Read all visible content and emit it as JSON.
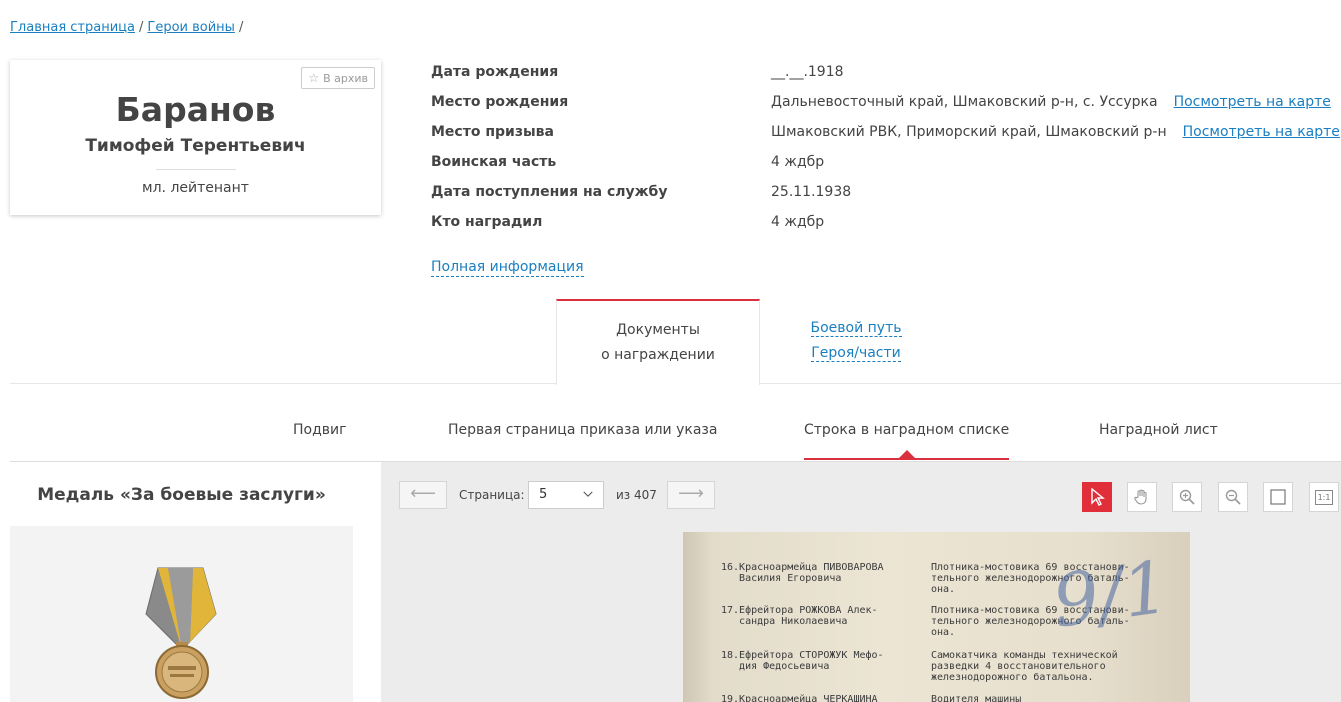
{
  "breadcrumb": [
    {
      "label": "Главная страница"
    },
    {
      "label": "Герои войны"
    }
  ],
  "breadcrumb_sep": "/",
  "hero": {
    "archive_label": "В архив",
    "surname": "Баранов",
    "given_names": "Тимофей Терентьевич",
    "rank": "мл. лейтенант"
  },
  "info": {
    "rows": [
      {
        "label": "Дата рождения",
        "value": "__.__.1918",
        "link": ""
      },
      {
        "label": "Место рождения",
        "value": "Дальневосточный край, Шмаковский р-н, с. Уссурка",
        "link": "Посмотреть на карте"
      },
      {
        "label": "Место призыва",
        "value": "Шмаковский РВК, Приморский край, Шмаковский р-н",
        "link": "Посмотреть на карте"
      },
      {
        "label": "Воинская часть",
        "value": "4 ждбр",
        "link": ""
      },
      {
        "label": "Дата поступления на службу",
        "value": "25.11.1938",
        "link": ""
      },
      {
        "label": "Кто наградил",
        "value": "4 ждбр",
        "link": ""
      }
    ],
    "full_info_label": "Полная информация"
  },
  "main_tabs": {
    "docs_line1": "Документы",
    "docs_line2": "о награждении",
    "path_line1": "Боевой путь",
    "path_line2": "Героя/части"
  },
  "sub_tabs": [
    {
      "label": "Подвиг"
    },
    {
      "label": "Первая страница приказа или указа"
    },
    {
      "label": "Строка в наградном списке",
      "active": true
    },
    {
      "label": "Наградной лист"
    }
  ],
  "award": {
    "title": "Медаль «За боевые заслуги»"
  },
  "viewer": {
    "prev_arrow": "⟵",
    "next_arrow": "⟶",
    "page_label": "Страница:",
    "page_value": "5",
    "page_of": "из 407",
    "tools": [
      "pointer-icon",
      "hand-icon",
      "zoom-in-icon",
      "zoom-out-icon",
      "fit-page-icon",
      "actual-size-icon"
    ],
    "tool_actual_size_text": "1:1"
  },
  "document_text": {
    "entries": [
      {
        "left": "16.Красноармейца ПИВОВАРОВА\n   Василия Егоровича",
        "right": "Плотника-мостовика 69 восстанови-\nтельного железнодорожного баталь-\nона."
      },
      {
        "left": "17.Ефрейтора РОЖКОВА Алек-\n   сандра Николаевича",
        "right": "Плотника-мостовика 69 восстанови-\nтельного железнодорожного баталь-\nона."
      },
      {
        "left": "18.Ефрейтора СТОРОЖУК Мефо-\n   дия Федосьевича",
        "right": "Самокатчика команды технической\nразведки 4 восстановительного\nжелезнодорожного батальона."
      },
      {
        "left": "19.Красноармейца ЧЕРКАШИНА",
        "right": "Водителя машины"
      }
    ],
    "signature": "9/1"
  },
  "colors": {
    "link": "#1a7fc1",
    "accent_red": "#d9313d"
  }
}
